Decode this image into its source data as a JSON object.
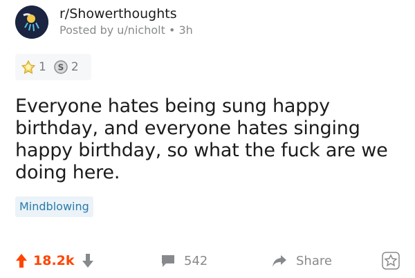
{
  "post": {
    "subreddit": "r/Showerthoughts",
    "posted_by": "Posted by u/nicholt",
    "time": "3h",
    "awards": [
      {
        "icon": "silver-award-icon",
        "count": "1"
      },
      {
        "icon": "coin-award-icon",
        "count": "2"
      }
    ],
    "title": "Everyone hates being sung happy birthday, and everyone hates singing happy birthday, so what the fuck are we doing here.",
    "flair": "Mindblowing"
  },
  "actions": {
    "score": "18.2k",
    "comments": "542",
    "share": "Share"
  },
  "colors": {
    "upvote": "#ff4500",
    "flair_bg": "#ebf3f8",
    "flair_text": "#2a7aa8",
    "muted": "#878a8c"
  }
}
